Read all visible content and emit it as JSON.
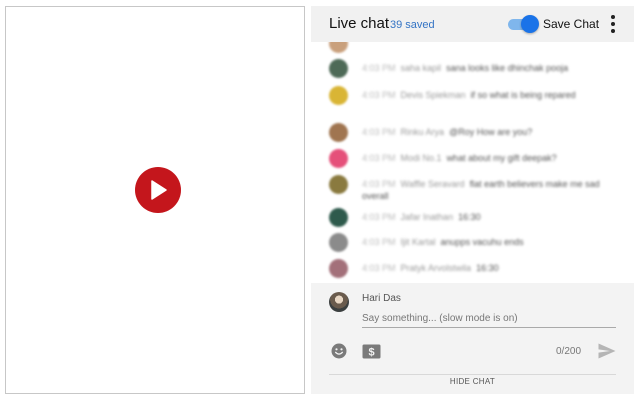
{
  "video": {
    "play_icon": "play-icon",
    "play_color": "#c4161c"
  },
  "chat": {
    "title": "Live chat",
    "saved_count": "39 saved",
    "save_chat_label": "Save Chat",
    "save_chat_enabled": true,
    "more_icon": "more-vert-icon",
    "accent": "#1a73e8",
    "messages": [
      {
        "author": "",
        "time": "",
        "text": "",
        "avatar_color": "#c9a07c"
      },
      {
        "author": "saha kapil",
        "time": "4:03 PM",
        "text": "sana looks like dhinchak pooja",
        "avatar_color": "#4e6a57"
      },
      {
        "author": "Devis Spiekman",
        "time": "4:03 PM",
        "text": "if so what is being repared",
        "avatar_color": "#d9b535"
      },
      {
        "author": "Rinku Arya",
        "time": "4:03 PM",
        "text": "@Roy How are you?",
        "avatar_color": "#a07550"
      },
      {
        "author": "Modi No.1",
        "time": "4:03 PM",
        "text": "what about my gift deepak?",
        "avatar_color": "#e5507a"
      },
      {
        "author": "Waffle Seravard",
        "time": "4:03 PM",
        "text": "flat earth believers make me sad overall",
        "avatar_color": "#8a7a3f"
      },
      {
        "author": "Jafar Inathan",
        "time": "4:03 PM",
        "text": "16:30",
        "avatar_color": "#2e5a4c"
      },
      {
        "author": "Ijit Kartal",
        "time": "4:03 PM",
        "text": "anupps vacuhu ends",
        "avatar_color": "#8b8b8b"
      },
      {
        "author": "Pratyk Arvolstwila",
        "time": "4:03 PM",
        "text": "16:30",
        "avatar_color": "#a3707a"
      }
    ]
  },
  "composer": {
    "user_name": "Hari Das",
    "placeholder": "Say something... (slow mode is on)",
    "value": "",
    "char_count": "0/200",
    "emoji_icon": "emoji-icon",
    "superchat_icon": "super-chat-icon",
    "send_icon": "send-icon"
  },
  "footer": {
    "hide_chat_label": "HIDE CHAT"
  }
}
